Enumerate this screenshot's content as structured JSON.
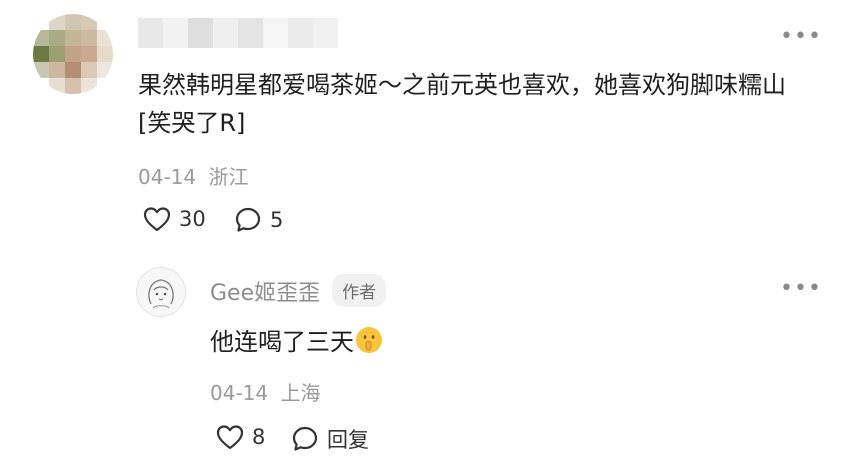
{
  "comment": {
    "text": "果然韩明星都爱喝茶姬～之前元英也喜欢，她喜欢狗脚味糯山[笑哭了R]",
    "date": "04-14",
    "location": "浙江",
    "likes": "30",
    "replies": "5",
    "more_icon": "more-icon"
  },
  "reply": {
    "username": "Gee姬歪歪",
    "badge": "作者",
    "text": "他连喝了三天",
    "emoji": "shushing-face-emoji",
    "date": "04-14",
    "location": "上海",
    "likes": "8",
    "reply_label": "回复",
    "more_icon": "more-icon"
  },
  "colors": {
    "text": "#1f1f1f",
    "meta": "#9a9a9a",
    "badge_bg": "#f1f1f1"
  }
}
